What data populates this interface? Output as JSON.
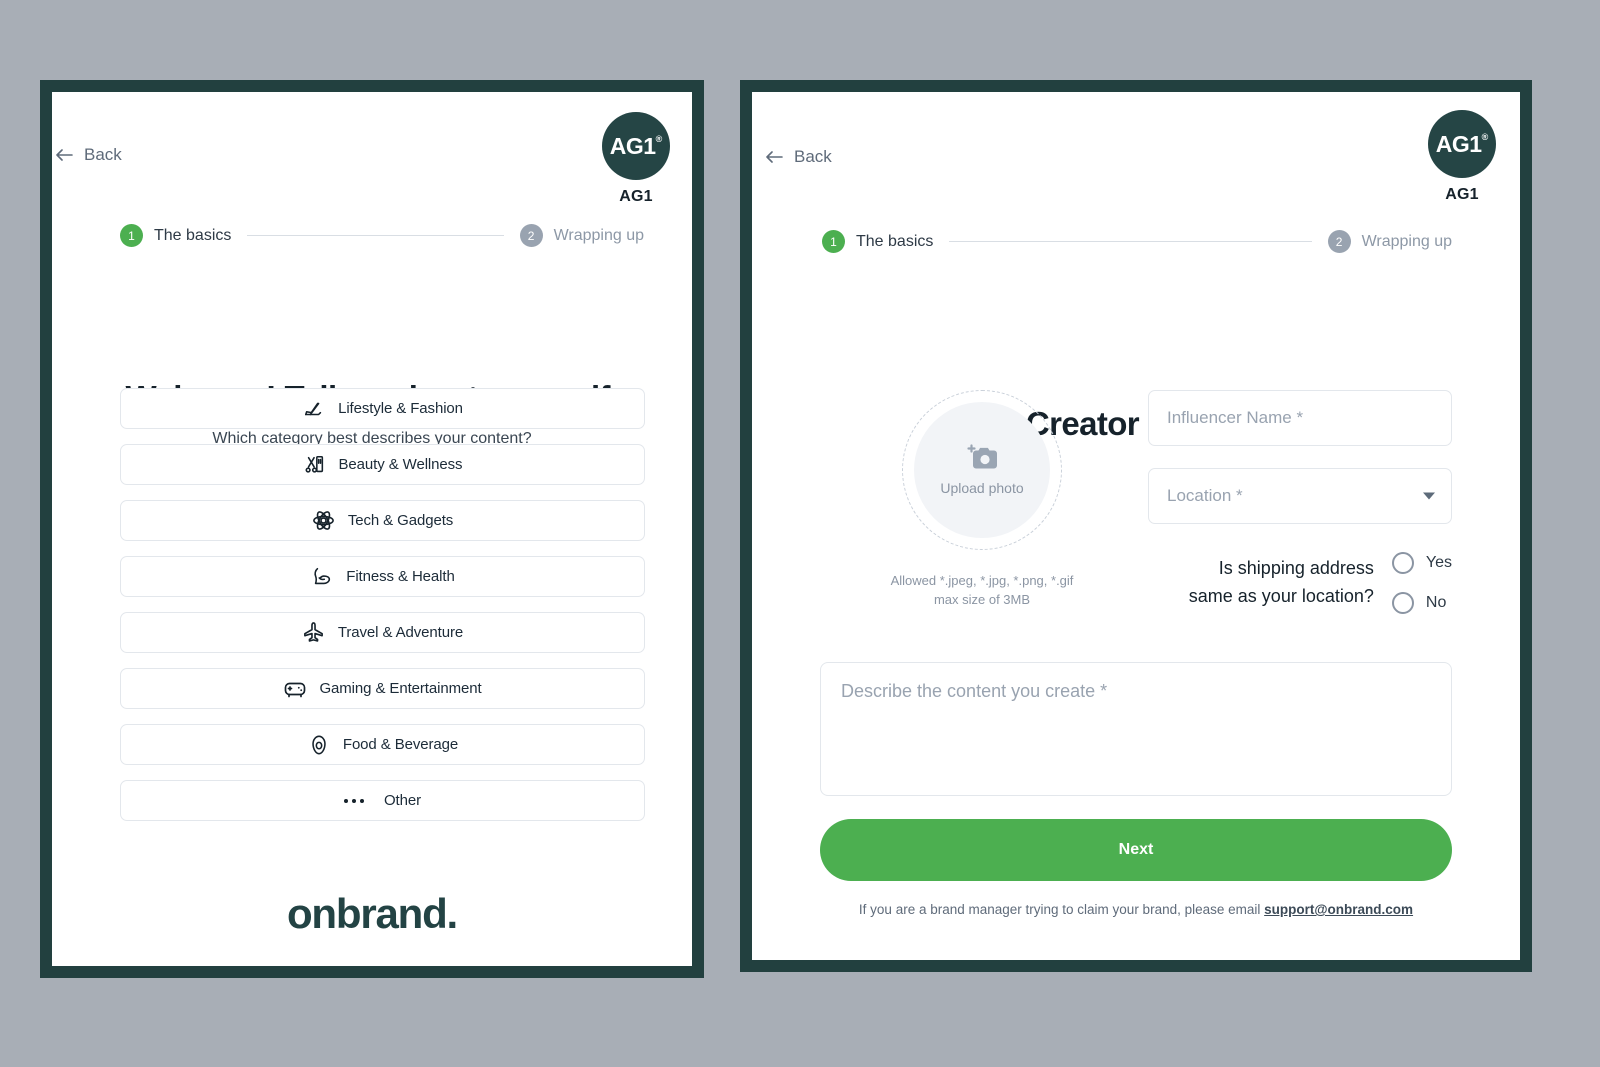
{
  "colors": {
    "page_background": "#a8aeb6",
    "card_border": "#22403f",
    "brand_dark": "#254545",
    "accent_green": "#4caf50",
    "muted_gray": "#99a3b0"
  },
  "left_card": {
    "back_label": "Back",
    "brand": {
      "mark": "AG1",
      "registered": "®",
      "name": "AG1"
    },
    "stepper": [
      {
        "number": "1",
        "label": "The basics",
        "state": "active"
      },
      {
        "number": "2",
        "label": "Wrapping up",
        "state": "inactive"
      }
    ],
    "headline": "Welcome! Tell us about yourself.",
    "subhead": "Which category best describes your content?",
    "categories": [
      {
        "label": "Lifestyle & Fashion",
        "icon": "high-heel-icon"
      },
      {
        "label": "Beauty & Wellness",
        "icon": "comb-scissors-icon"
      },
      {
        "label": "Tech & Gadgets",
        "icon": "atom-icon"
      },
      {
        "label": "Fitness & Health",
        "icon": "flexed-bicep-icon"
      },
      {
        "label": "Travel & Adventure",
        "icon": "airplane-icon"
      },
      {
        "label": "Gaming & Entertainment",
        "icon": "gamepad-icon"
      },
      {
        "label": "Food & Beverage",
        "icon": "avocado-icon"
      },
      {
        "label": "Other",
        "icon": "ellipsis-icon"
      }
    ],
    "logo": "onbrand."
  },
  "right_card": {
    "back_label": "Back",
    "brand": {
      "mark": "AG1",
      "registered": "®",
      "name": "AG1"
    },
    "stepper": [
      {
        "number": "1",
        "label": "The basics",
        "state": "active"
      },
      {
        "number": "2",
        "label": "Wrapping up",
        "state": "inactive"
      }
    ],
    "headline": "Creator Profile",
    "upload": {
      "icon": "camera-plus-icon",
      "label": "Upload photo",
      "hint_line1": "Allowed *.jpeg, *.jpg, *.png, *.gif",
      "hint_line2": "max size of 3MB"
    },
    "fields": {
      "influencer_name": {
        "placeholder": "Influencer Name *",
        "value": ""
      },
      "location": {
        "placeholder": "Location *",
        "value": "",
        "icon": "chevron-down-icon"
      }
    },
    "shipping": {
      "question_line1": "Is shipping address",
      "question_line2": "same as your location?",
      "options": [
        {
          "label": "Yes",
          "selected": false
        },
        {
          "label": "No",
          "selected": false
        }
      ]
    },
    "description": {
      "placeholder": "Describe the content you create *",
      "value": ""
    },
    "next_label": "Next",
    "footnote": {
      "text": "If you are a brand manager trying to claim your brand, please email ",
      "email": "support@onbrand.com"
    }
  }
}
